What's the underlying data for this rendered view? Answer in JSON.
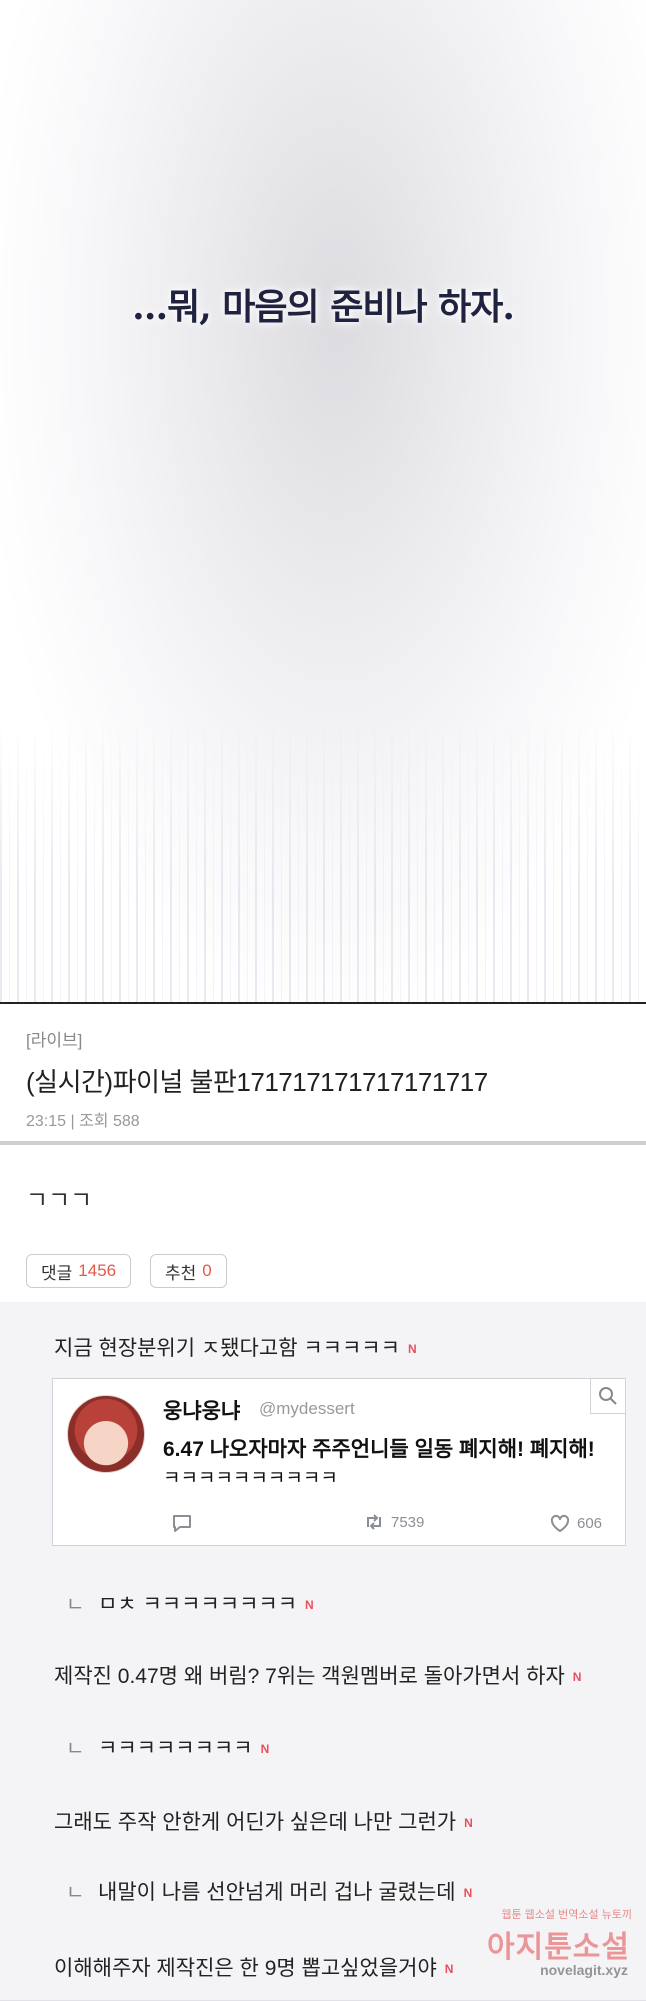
{
  "panel": {
    "dialogue": "…뭐, 마음의 준비나 하자."
  },
  "post": {
    "category": "[라이브]",
    "title": "(실시간)파이널 불판171717171717171717",
    "meta": "23:15 | 조회 588",
    "body": "ㄱㄱㄱ",
    "comment_label": "댓글",
    "comment_count": "1456",
    "recommend_label": "추천",
    "recommend_count": "0"
  },
  "comments": [
    {
      "text": "지금 현장분위기 ㅈ됐다고함 ㅋㅋㅋㅋㅋ",
      "badge": "N"
    },
    {
      "text": "ㅁㅊ ㅋㅋㅋㅋㅋㅋㅋㅋ",
      "badge": "N",
      "reply": "ㄴ"
    },
    {
      "text": "제작진 0.47명 왜 버림? 7위는 객원멤버로 돌아가면서 하자",
      "badge": "N"
    },
    {
      "text": "ㅋㅋㅋㅋㅋㅋㅋㅋ",
      "badge": "N",
      "reply": "ㄴ"
    },
    {
      "text": "그래도 주작 안한게 어딘가 싶은데 나만 그런가",
      "badge": "N"
    },
    {
      "text": "내말이 나름 선안넘게 머리 겁나 굴렸는데",
      "badge": "N",
      "reply": "ㄴ"
    },
    {
      "text": "이해해주자 제작진은 한 9명 뽑고싶었을거야",
      "badge": "N"
    }
  ],
  "tweet": {
    "name": "웅냐웅냐",
    "handle": "@mydessert",
    "text_line1": "6.47 나오자마자 주주언니들 일동 폐지해! 폐지해!",
    "text_line2": "ㅋㅋㅋㅋㅋㅋㅋㅋㅋㅋ",
    "retweets": "7539",
    "likes": "606"
  },
  "watermark": {
    "top": "웹툰 웹소설 번역소설 뉴토끼",
    "main": "아지툰소설",
    "url": "novelagit.xyz"
  }
}
